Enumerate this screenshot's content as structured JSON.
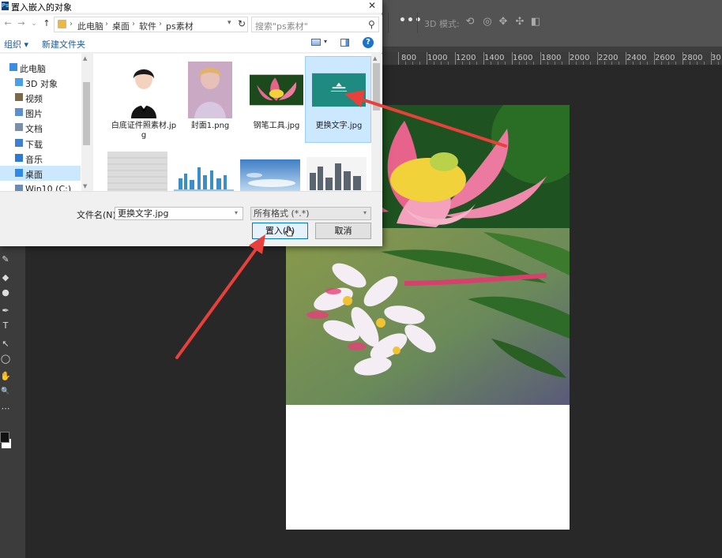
{
  "dialog": {
    "title": "置入嵌入的对象",
    "close_glyph": "✕",
    "nav": {
      "back": "←",
      "forward": "→",
      "history": "⌄",
      "up": "↑"
    },
    "breadcrumb": [
      "此电脑",
      "桌面",
      "软件",
      "ps素材"
    ],
    "search_placeholder": "搜索\"ps素材\"",
    "toolbar": {
      "organize": "组织 ▾",
      "new_folder": "新建文件夹",
      "help": "?"
    },
    "nav_pane": [
      {
        "label": "此电脑",
        "icon": "computer-icon",
        "color": "#3d8ee0"
      },
      {
        "label": "3D 对象",
        "icon": "3d-objects-icon",
        "color": "#4aa0e8"
      },
      {
        "label": "视频",
        "icon": "video-folder-icon",
        "color": "#7a6a4a"
      },
      {
        "label": "图片",
        "icon": "pictures-folder-icon",
        "color": "#5b8fd0"
      },
      {
        "label": "文档",
        "icon": "documents-folder-icon",
        "color": "#7c8fa8"
      },
      {
        "label": "下载",
        "icon": "downloads-folder-icon",
        "color": "#3f7fd0"
      },
      {
        "label": "音乐",
        "icon": "music-folder-icon",
        "color": "#2c7ad6"
      },
      {
        "label": "桌面",
        "icon": "desktop-folder-icon",
        "color": "#2e8ae6",
        "selected": true
      },
      {
        "label": "Win10 (C:)",
        "icon": "drive-icon",
        "color": "#6a8bb3"
      }
    ],
    "files_row1": [
      {
        "name": "白底证件照素材.jpg",
        "kind": "portrait"
      },
      {
        "name": "封面1.png",
        "kind": "cover"
      },
      {
        "name": "钢笔工具.jpg",
        "kind": "lotus"
      },
      {
        "name": "更换文字.jpg",
        "kind": "teal",
        "selected": true
      }
    ],
    "files_row2": [
      {
        "kind": "texture"
      },
      {
        "kind": "skyline"
      },
      {
        "kind": "sky"
      },
      {
        "kind": "buildings"
      }
    ],
    "filename_label": "文件名(N):",
    "filename_value": "更换文字.jpg",
    "filetype_value": "所有格式 (*.*)",
    "insert_button": "置入(P)",
    "cancel_button": "取消"
  },
  "photoshop": {
    "mode_3d": "3D 模式:",
    "more": "•••",
    "ruler_labels": [
      "800",
      "1000",
      "1200",
      "1400",
      "1600",
      "1800",
      "2000",
      "2200",
      "2400",
      "2600",
      "2800",
      "30"
    ],
    "tools": [
      "✎",
      "◆",
      "●",
      "✒",
      "T",
      "↖",
      "◯",
      "✋",
      "🔍",
      "⋯"
    ],
    "annotation_color": "#e8403a"
  }
}
